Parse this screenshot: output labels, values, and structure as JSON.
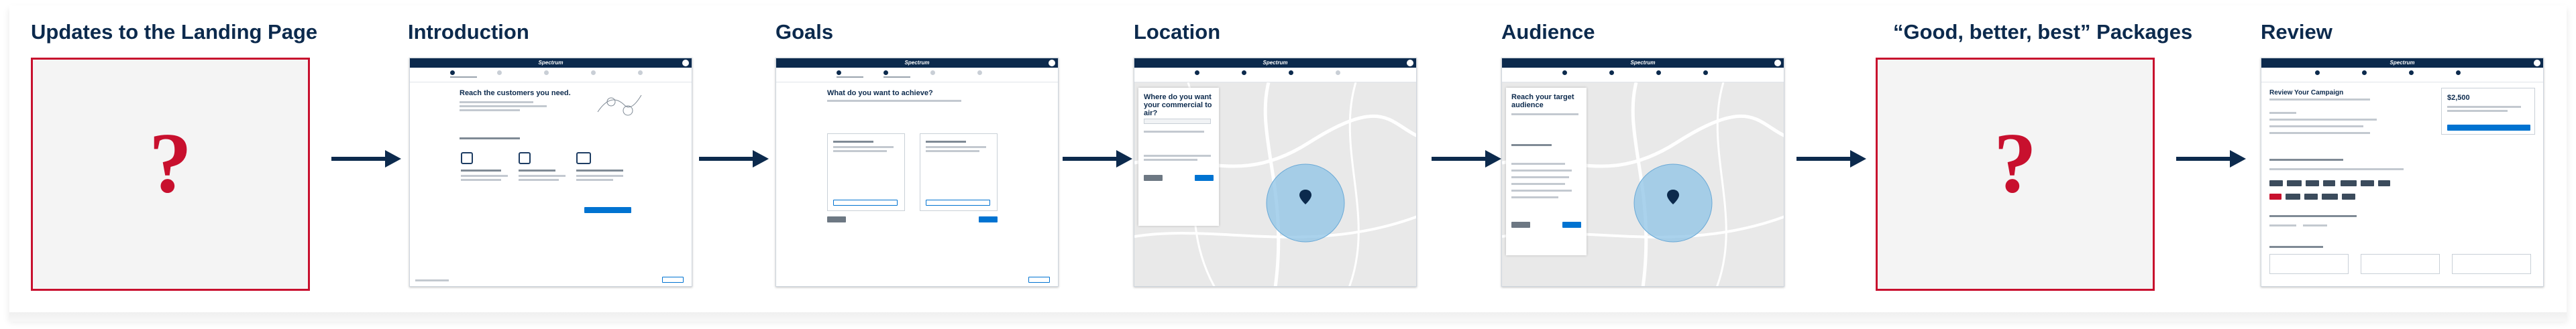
{
  "steps": [
    {
      "id": "landing",
      "title": "Updates to the Landing Page",
      "placeholder": "?"
    },
    {
      "id": "introduction",
      "title": "Introduction",
      "screen": {
        "heading": "Reach the customers you need.",
        "brand": "Spectrum"
      }
    },
    {
      "id": "goals",
      "title": "Goals",
      "screen": {
        "heading": "What do you want to achieve?",
        "brand": "Spectrum"
      }
    },
    {
      "id": "location",
      "title": "Location",
      "screen": {
        "heading": "Where do you want your commercial to air?",
        "brand": "Spectrum"
      }
    },
    {
      "id": "audience",
      "title": "Audience",
      "screen": {
        "heading": "Reach your target audience",
        "brand": "Spectrum"
      }
    },
    {
      "id": "packages",
      "title": "“Good, better, best” Packages",
      "placeholder": "?"
    },
    {
      "id": "review",
      "title": "Review",
      "screen": {
        "heading": "Review Your Campaign",
        "brand": "Spectrum",
        "price": "$2,500"
      }
    }
  ],
  "colors": {
    "navy": "#0c2a4d",
    "accent_red": "#c8102e",
    "link_blue": "#0073d1",
    "map_circle": "#8ec3e6"
  },
  "icons": {
    "flow_arrow": "arrow-right-icon",
    "map_pin": "map-pin-icon"
  }
}
